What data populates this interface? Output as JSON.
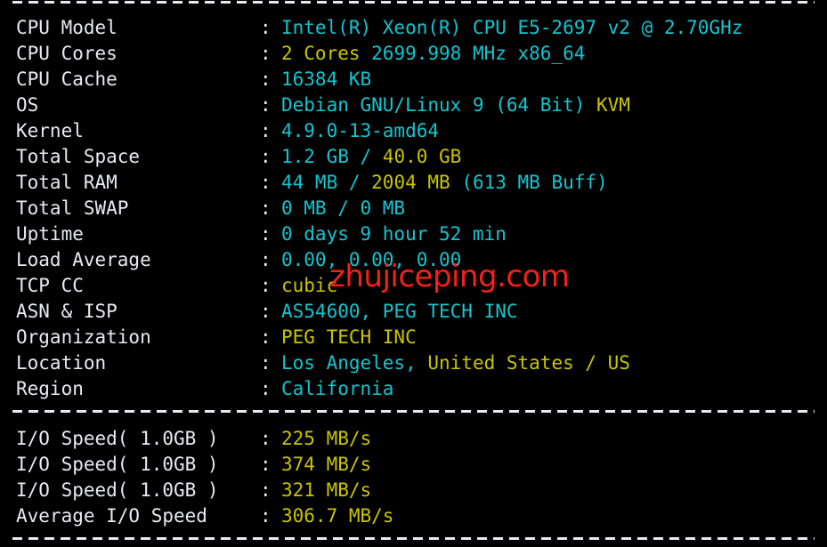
{
  "terminal": {
    "background": "#000000",
    "label_color": "#e8eaee",
    "cyan": "#12c5d0",
    "yellow": "#c9c400",
    "watermark_color": "#f5201a",
    "separator_char": "-"
  },
  "watermark": {
    "text": "zhujiceping.com"
  },
  "separators": {
    "top": "----------------------------------------------------------------------",
    "middle": "----------------------------------------------------------------------",
    "bottom": "----------------------------------------------------------------------"
  },
  "system_info": {
    "colon": ":",
    "rows": [
      {
        "label": "CPU Model",
        "segments": [
          {
            "text": "Intel(R) Xeon(R) CPU E5-2697 v2 @ 2.70GHz",
            "color": "cyan"
          }
        ]
      },
      {
        "label": "CPU Cores",
        "segments": [
          {
            "text": "2 Cores ",
            "color": "yellow"
          },
          {
            "text": "2699.998 MHz x86_64",
            "color": "cyan"
          }
        ]
      },
      {
        "label": "CPU Cache",
        "segments": [
          {
            "text": "16384 KB",
            "color": "cyan"
          }
        ]
      },
      {
        "label": "OS",
        "segments": [
          {
            "text": "Debian GNU/Linux 9 (64 Bit) ",
            "color": "cyan"
          },
          {
            "text": "KVM",
            "color": "yellow"
          }
        ]
      },
      {
        "label": "Kernel",
        "segments": [
          {
            "text": "4.9.0-13-amd64",
            "color": "cyan"
          }
        ]
      },
      {
        "label": "Total Space",
        "segments": [
          {
            "text": "1.2 GB ",
            "color": "cyan"
          },
          {
            "text": "/ ",
            "color": "cyan"
          },
          {
            "text": "40.0 GB",
            "color": "yellow"
          }
        ]
      },
      {
        "label": "Total RAM",
        "segments": [
          {
            "text": "44 MB ",
            "color": "cyan"
          },
          {
            "text": "/ ",
            "color": "cyan"
          },
          {
            "text": "2004 MB ",
            "color": "yellow"
          },
          {
            "text": "(613 MB Buff)",
            "color": "cyan"
          }
        ]
      },
      {
        "label": "Total SWAP",
        "segments": [
          {
            "text": "0 MB / 0 MB",
            "color": "cyan"
          }
        ]
      },
      {
        "label": "Uptime",
        "segments": [
          {
            "text": "0 days 9 hour 52 min",
            "color": "cyan"
          }
        ]
      },
      {
        "label": "Load Average",
        "segments": [
          {
            "text": "0.00, 0.00, 0.00",
            "color": "cyan"
          }
        ]
      },
      {
        "label": "TCP CC",
        "segments": [
          {
            "text": "cubic",
            "color": "yellow"
          }
        ]
      },
      {
        "label": "ASN & ISP",
        "segments": [
          {
            "text": "AS54600, PEG TECH INC",
            "color": "cyan"
          }
        ]
      },
      {
        "label": "Organization",
        "segments": [
          {
            "text": "PEG TECH INC",
            "color": "yellow"
          }
        ]
      },
      {
        "label": "Location",
        "segments": [
          {
            "text": "Los Angeles, ",
            "color": "cyan"
          },
          {
            "text": "United States / US",
            "color": "yellow"
          }
        ]
      },
      {
        "label": "Region",
        "segments": [
          {
            "text": "California",
            "color": "cyan"
          }
        ]
      }
    ]
  },
  "io_speed": {
    "colon": ":",
    "rows": [
      {
        "label": "I/O Speed( 1.0GB )",
        "segments": [
          {
            "text": "225 MB/s",
            "color": "yellow"
          }
        ]
      },
      {
        "label": "I/O Speed( 1.0GB )",
        "segments": [
          {
            "text": "374 MB/s",
            "color": "yellow"
          }
        ]
      },
      {
        "label": "I/O Speed( 1.0GB )",
        "segments": [
          {
            "text": "321 MB/s",
            "color": "yellow"
          }
        ]
      },
      {
        "label": "Average I/O Speed",
        "segments": [
          {
            "text": "306.7 MB/s",
            "color": "yellow"
          }
        ]
      }
    ]
  }
}
